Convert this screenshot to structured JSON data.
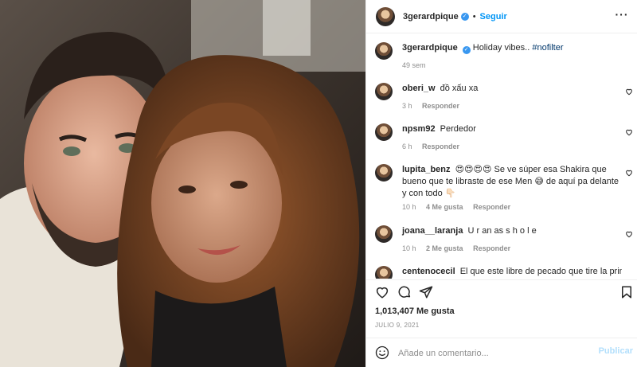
{
  "post": {
    "author": "3gerardpique",
    "follow_label": "Seguir",
    "dot": "•",
    "more_label": "···"
  },
  "caption": {
    "username": "3gerardpique",
    "text": "Holiday vibes..",
    "hashtag": "#nofilter",
    "time": "49 sem"
  },
  "comments": [
    {
      "username": "oberi_w",
      "text": "đồ xấu xa",
      "time": "3 h",
      "likes": "",
      "reply": "Responder"
    },
    {
      "username": "npsm92",
      "text": "Perdedor",
      "time": "6 h",
      "likes": "",
      "reply": "Responder"
    },
    {
      "username": "lupita_benz",
      "text": "😍😍😍😍 Se ve súper esa Shakira que bueno que te libraste de ese Men 😅 de aquí pa delante y con todo 👇🏻",
      "time": "10 h",
      "likes": "4 Me gusta",
      "reply": "Responder"
    },
    {
      "username": "joana__laranja",
      "text": "U r an as s h o l e",
      "time": "10 h",
      "likes": "2 Me gusta",
      "reply": "Responder"
    },
    {
      "username": "centenocecil",
      "text": "El que este libre de pecado que tire la primera",
      "time": "",
      "likes": "",
      "reply": ""
    }
  ],
  "stats": {
    "likes": "1,013,407 Me gusta",
    "date": "JULIO 9, 2021"
  },
  "add_comment": {
    "placeholder": "Añade un comentario...",
    "publish_label": "Publicar"
  },
  "icons": {
    "verified": "verified-badge-icon",
    "like": "heart-icon",
    "comment": "comment-bubble-icon",
    "share": "paper-plane-icon",
    "save": "bookmark-icon",
    "emoji": "smiley-icon",
    "more": "ellipsis-icon"
  },
  "colors": {
    "accent": "#0095f6",
    "verified": "#3897f0",
    "muted": "#8e8e8e",
    "publish_disabled": "#b2dffc"
  }
}
